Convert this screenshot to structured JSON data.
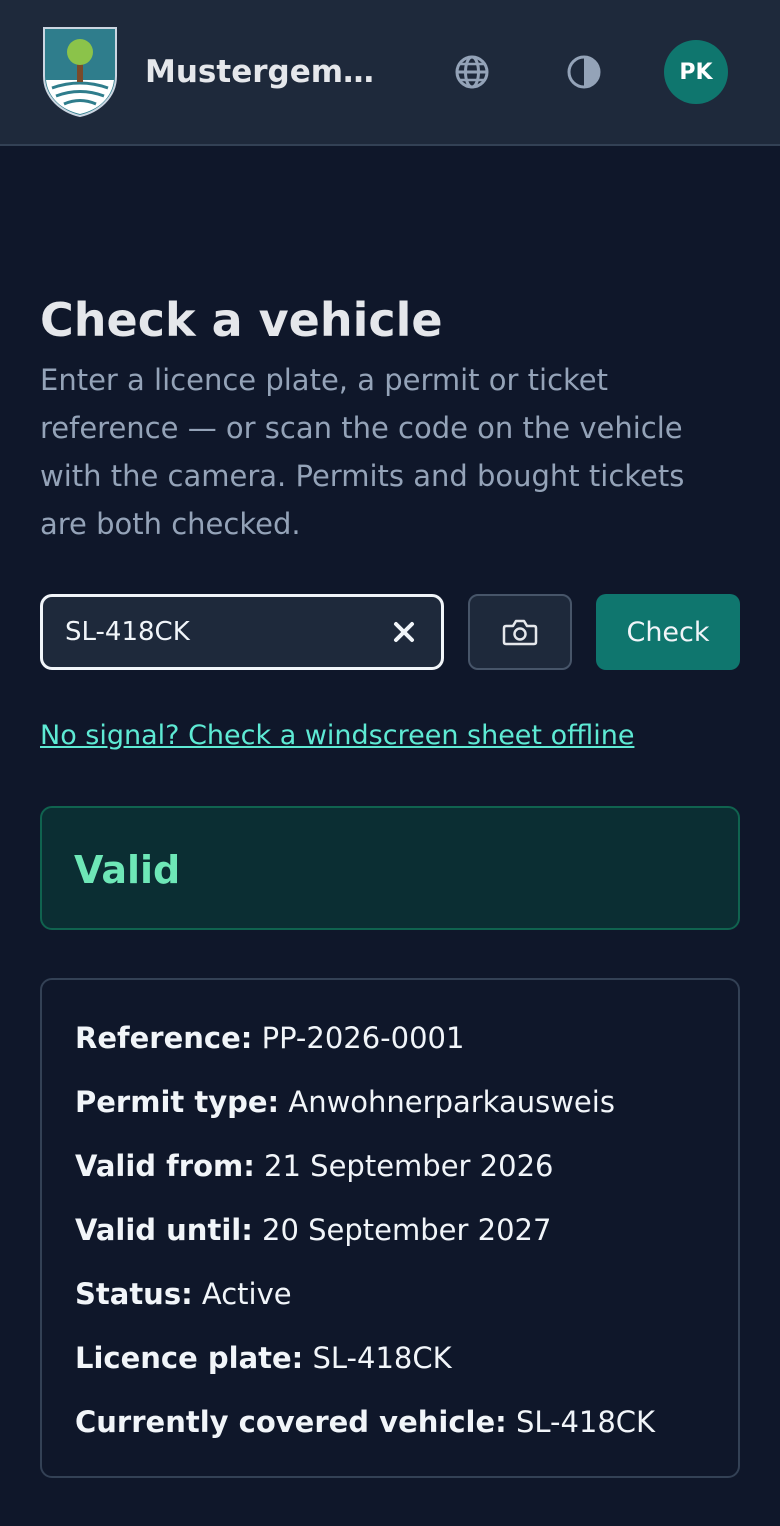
{
  "header": {
    "app_title": "Mustergemeinde",
    "globe_icon": "globe-icon",
    "contrast_icon": "contrast-icon",
    "avatar_initials": "PK",
    "logo_colors": {
      "shield": "#2f7d8c",
      "tree": "#8bc34a",
      "trunk": "#7a4a2a",
      "water": "#ffffff"
    }
  },
  "main": {
    "title": "Check a vehicle",
    "intro": "Enter a licence plate, a permit or ticket reference — or scan the code on the vehicle with the camera. Permits and bought tickets are both checked.",
    "search": {
      "value": "SL-418CK",
      "clear_icon": "close-icon",
      "camera_icon": "camera-icon"
    },
    "check_label": "Check",
    "offline_link": "No signal? Check a windscreen sheet offline",
    "result": {
      "status": "Valid",
      "color": "#6ee7b7"
    },
    "details": [
      {
        "label": "Reference:",
        "value": "PP-2026-0001"
      },
      {
        "label": "Permit type:",
        "value": "Anwohnerparkausweis"
      },
      {
        "label": "Valid from:",
        "value": "21 September 2026"
      },
      {
        "label": "Valid until:",
        "value": "20 September 2027"
      },
      {
        "label": "Status:",
        "value": "Active"
      },
      {
        "label": "Licence plate:",
        "value": "SL-418CK"
      },
      {
        "label": "Currently covered vehicle:",
        "value": "SL-418CK"
      }
    ]
  },
  "colors": {
    "background": "#0f172a",
    "header": "#1e293b",
    "accent": "#0f766e",
    "link": "#5eead4"
  }
}
